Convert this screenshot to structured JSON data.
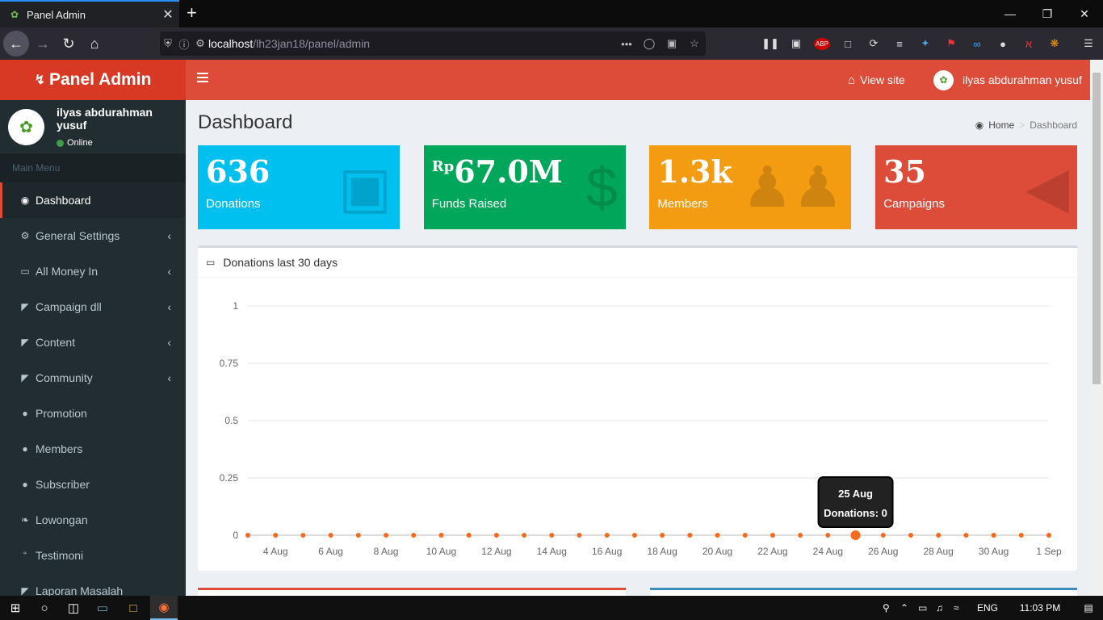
{
  "browser": {
    "tab_title": "Panel Admin",
    "url_host": "localhost",
    "url_path": "/lh23jan18/panel/admin"
  },
  "app": {
    "logo_text": "Panel Admin",
    "user_name": "ilyas abdurahman yusuf",
    "user_status": "Online",
    "header_view_site": "View site",
    "header_user_name": "ilyas abdurahman yusuf"
  },
  "sidebar": {
    "header": "Main Menu",
    "items": [
      {
        "label": "Dashboard",
        "icon": "dashboard-icon",
        "active": true,
        "chevron": false
      },
      {
        "label": "General Settings",
        "icon": "cogs-icon",
        "active": false,
        "chevron": true
      },
      {
        "label": "All Money In",
        "icon": "money-icon",
        "active": false,
        "chevron": true
      },
      {
        "label": "Campaign dll",
        "icon": "bullhorn-icon",
        "active": false,
        "chevron": true
      },
      {
        "label": "Content",
        "icon": "bullhorn-icon",
        "active": false,
        "chevron": true
      },
      {
        "label": "Community",
        "icon": "bullhorn-icon",
        "active": false,
        "chevron": true
      },
      {
        "label": "Promotion",
        "icon": "user-icon",
        "active": false,
        "chevron": false
      },
      {
        "label": "Members",
        "icon": "user-icon",
        "active": false,
        "chevron": false
      },
      {
        "label": "Subscriber",
        "icon": "user-icon",
        "active": false,
        "chevron": false
      },
      {
        "label": "Lowongan",
        "icon": "leaf-icon",
        "active": false,
        "chevron": false
      },
      {
        "label": "Testimoni",
        "icon": "quote-icon",
        "active": false,
        "chevron": false
      },
      {
        "label": "Laporan Masalah",
        "icon": "bullhorn-icon",
        "active": false,
        "chevron": false
      }
    ]
  },
  "page": {
    "title": "Dashboard",
    "breadcrumb_home": "Home",
    "breadcrumb_current": "Dashboard"
  },
  "stats": [
    {
      "prefix": "",
      "value": "636",
      "label": "Donations",
      "color": "#00c0ef",
      "icon": "money-icon"
    },
    {
      "prefix": "Rp",
      "value": "67.0M",
      "label": "Funds Raised",
      "color": "#00a65a",
      "icon": "dollar-icon"
    },
    {
      "prefix": "",
      "value": "1.3k",
      "label": "Members",
      "color": "#f39c12",
      "icon": "users-icon"
    },
    {
      "prefix": "",
      "value": "35",
      "label": "Campaigns",
      "color": "#dd4b39",
      "icon": "bullhorn-icon"
    }
  ],
  "chart_box_title": "Donations last 30 days",
  "chart_data": {
    "type": "line",
    "x": [
      "3 Aug",
      "4 Aug",
      "5 Aug",
      "6 Aug",
      "7 Aug",
      "8 Aug",
      "9 Aug",
      "10 Aug",
      "11 Aug",
      "12 Aug",
      "13 Aug",
      "14 Aug",
      "15 Aug",
      "16 Aug",
      "17 Aug",
      "18 Aug",
      "19 Aug",
      "20 Aug",
      "21 Aug",
      "22 Aug",
      "23 Aug",
      "24 Aug",
      "25 Aug",
      "26 Aug",
      "27 Aug",
      "28 Aug",
      "29 Aug",
      "30 Aug",
      "31 Aug",
      "1 Sep"
    ],
    "x_tick_labels": [
      "4 Aug",
      "6 Aug",
      "8 Aug",
      "10 Aug",
      "12 Aug",
      "14 Aug",
      "16 Aug",
      "18 Aug",
      "20 Aug",
      "22 Aug",
      "24 Aug",
      "26 Aug",
      "28 Aug",
      "30 Aug",
      "1 Sep"
    ],
    "series": [
      {
        "values": [
          0,
          0,
          0,
          0,
          0,
          0,
          0,
          0,
          0,
          0,
          0,
          0,
          0,
          0,
          0,
          0,
          0,
          0,
          0,
          0,
          0,
          0,
          0,
          0,
          0,
          0,
          0,
          0,
          0,
          0
        ]
      }
    ],
    "ylim": [
      0,
      1
    ],
    "y_ticks": [
      "0",
      "0.25",
      "0.5",
      "0.75",
      "1"
    ],
    "tooltip": {
      "title": "25 Aug",
      "body": "Donations: 0",
      "index": 22
    },
    "color": "#f56a1d"
  },
  "taskbar": {
    "lang": "ENG",
    "time": "11:03 PM"
  }
}
